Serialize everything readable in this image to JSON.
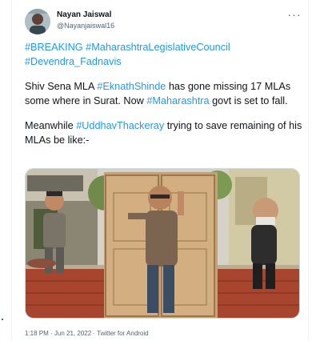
{
  "tweet": {
    "author_name": "Nayan Jaiswal",
    "author_handle": "@Nayanjaiswal16",
    "hashtags_line1": "#BREAKING #MaharashtraLegislativeCouncil",
    "hashtags_line2": "#Devendra_Fadnavis",
    "p2_a": "Shiv Sena MLA ",
    "p2_tag1": "#EknathShinde",
    "p2_b": " has gone missing 17 MLAs some where in Surat. Now ",
    "p2_tag2": "#Maharashtra",
    "p2_c": " govt is set to fall.",
    "p3_a": "Meanwhile ",
    "p3_tag": "#UddhavThackeray",
    "p3_b": " trying to save remaining of his MLAs be like:-",
    "timestamp": "1:18 PM · Jun 21, 2022 · Twitter for Android",
    "more_glyph": "···"
  },
  "colors": {
    "link": "#1d9bf0",
    "text": "#0f1419",
    "secondary": "#536471",
    "border": "#cfd9de"
  },
  "icons": {
    "more": "more-horizontal-icon",
    "avatar": "avatar"
  }
}
